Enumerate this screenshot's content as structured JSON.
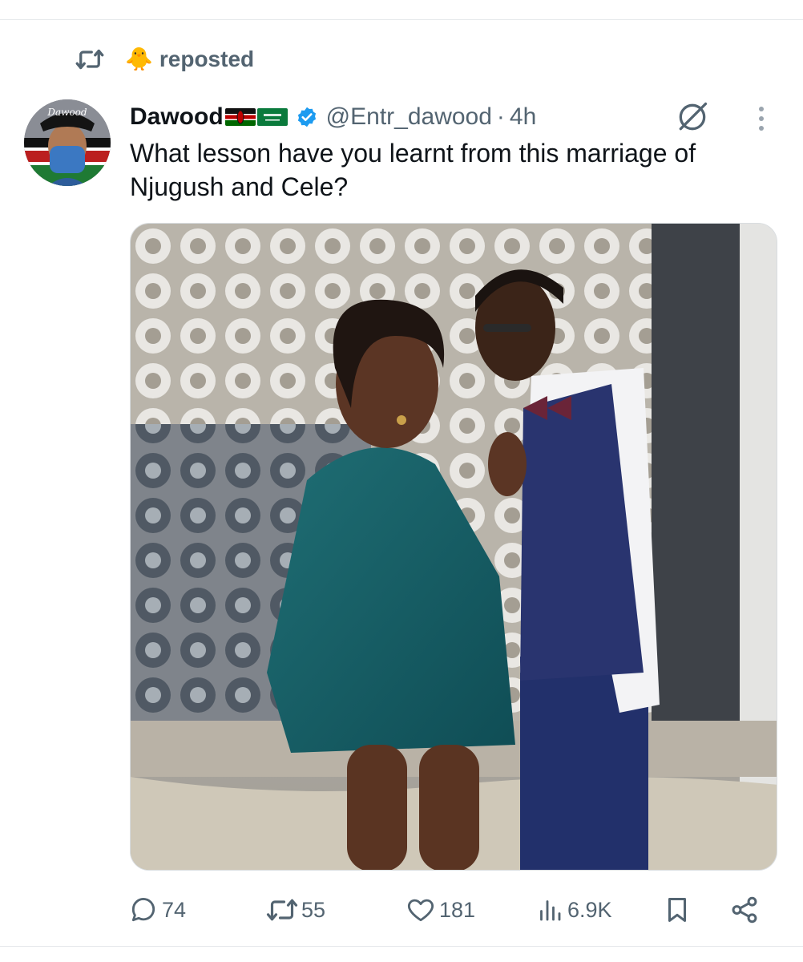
{
  "repost": {
    "icon": "repost-icon",
    "emoji": "🐥",
    "label": "reposted"
  },
  "tweet": {
    "author": {
      "name": "Dawood",
      "flags": [
        "kenya-flag",
        "saudi-flag"
      ],
      "verified": true,
      "handle": "@Entr_dawood",
      "separator": "·",
      "time": "4h",
      "avatar_text": "Dawood"
    },
    "text": "What lesson have you learnt from this marriage of Njugush and Cele?",
    "media": {
      "type": "photo"
    },
    "actions": {
      "replies": "74",
      "reposts": "55",
      "likes": "181",
      "views": "6.9K"
    }
  },
  "colors": {
    "text_primary": "#0f1419",
    "text_secondary": "#536471",
    "verified_blue": "#1d9bf0",
    "divider": "#e6e9ec"
  }
}
